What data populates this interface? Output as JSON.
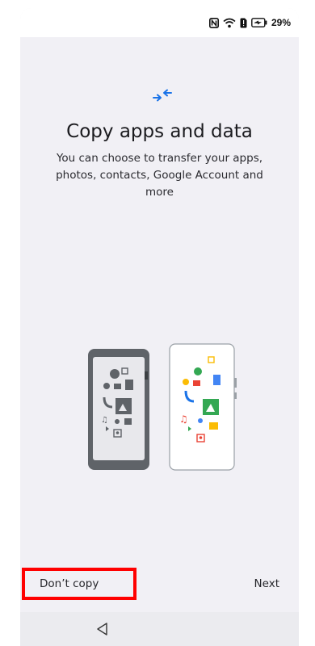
{
  "status_bar": {
    "battery_text": "29%",
    "icons": [
      "nfc-icon",
      "wifi-icon",
      "sim-icon",
      "battery-icon"
    ]
  },
  "header": {
    "icon": "transfer-arrows-icon",
    "title": "Copy apps and data",
    "subtitle": "You can choose to transfer your apps, photos, contacts, Google Account and more"
  },
  "illustration": {
    "description_icons": [
      "old-phone-icon",
      "new-phone-icon"
    ]
  },
  "actions": {
    "dont_copy_label": "Don’t copy",
    "next_label": "Next"
  },
  "nav": {
    "back_icon": "back-triangle-icon"
  },
  "colors": {
    "background": "#f1f0f5",
    "accent_blue": "#1a73e8",
    "highlight_red": "#ff0000"
  }
}
